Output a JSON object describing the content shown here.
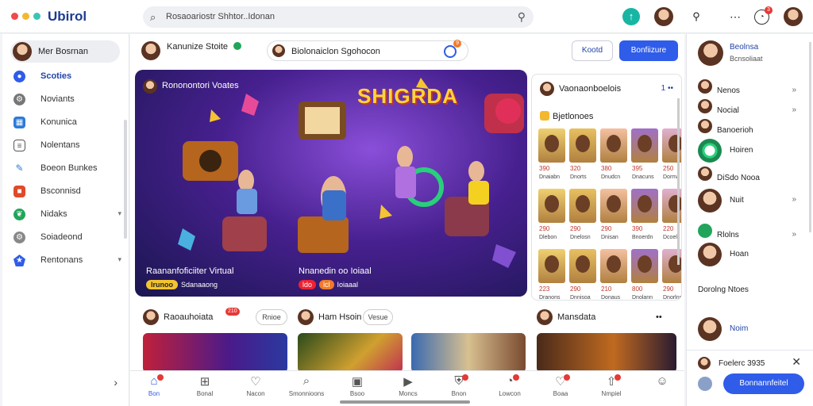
{
  "colors": {
    "accent": "#2f5ce8",
    "brand": "#1d3b8f",
    "badge": "#e53935",
    "verified": "#22a55a"
  },
  "topbar": {
    "brand": "Ubirol",
    "search_placeholder": "Rosaoariostr Shhtor..Idonan",
    "notif_count": "3"
  },
  "sidebar": {
    "profile_name": "Mer Bosrnan",
    "items": [
      {
        "label": "Scoties",
        "icon": "circle-icon"
      },
      {
        "label": "Noviants",
        "icon": "gear-icon"
      },
      {
        "label": "Konunica",
        "icon": "grid-icon"
      },
      {
        "label": "Nolentans",
        "icon": "list-icon"
      },
      {
        "label": "Boeon Bunkes",
        "icon": "pen-icon"
      },
      {
        "label": "Bsconnisd",
        "icon": "square-icon"
      },
      {
        "label": "Nidaks",
        "icon": "leaf-icon"
      },
      {
        "label": "Soiadeond",
        "icon": "settings-icon"
      },
      {
        "label": "Rentonans",
        "icon": "star-icon"
      }
    ]
  },
  "main": {
    "header": {
      "name": "Kanunize Stoite",
      "pill_text": "Biolonaiclon Sgohocon",
      "pill_badge": "9",
      "btn_secondary": "Kootd",
      "btn_primary": "Bonfiizure"
    },
    "hero": {
      "host": "Rononontori Voates",
      "logo": "SHIGRDA",
      "caption_left": "Raananfoficiiter Virtual",
      "tag_left": "lrunoo",
      "tag_left_text": "Sdanaaong",
      "caption_right": "Nnanedin oo Ioiaal",
      "tag_right_a": "ldo",
      "tag_right_b": "lcl",
      "tag_right_text": "Ioiaaal"
    },
    "gallery": {
      "title": "Vaonaonboelois",
      "more": "1 ••",
      "subtitle": "Bjetlonoes",
      "labels": [
        "390",
        "320",
        "380",
        "395",
        "250",
        "290",
        "290",
        "290",
        "390",
        "220",
        "223",
        "290",
        "210",
        "800",
        "290"
      ],
      "footer_labels": [
        "Dnaiabn",
        "Dnorts",
        "Dnudcn",
        "Dnacuns",
        "Dorma",
        "Dlebon",
        "Dnelosn",
        "Dnisan",
        "Bnoerdn",
        "Dcoels",
        "Dranons",
        "Dnnisoa",
        "Donaus",
        "Dnolann",
        "Dnorlns"
      ]
    },
    "sections": [
      {
        "title": "Raoauhoiata",
        "badge": "210",
        "btn": "Rnioe"
      },
      {
        "title": "Ham Hsoin",
        "btn": "Vesue"
      },
      {
        "title": "Mansdata",
        "more": "••"
      }
    ],
    "bottom_nav": [
      {
        "label": "Bon",
        "icon": "home-icon"
      },
      {
        "label": "Bonal",
        "icon": "plus-square-icon"
      },
      {
        "label": "Nacon",
        "icon": "heart-icon"
      },
      {
        "label": "Smonnioons",
        "icon": "search-icon"
      },
      {
        "label": "Bsoo",
        "icon": "gamepad-icon"
      },
      {
        "label": "Moncs",
        "icon": "video-icon"
      },
      {
        "label": "Bnon",
        "icon": "shield-icon"
      },
      {
        "label": "Lowcon",
        "icon": "bell-icon"
      },
      {
        "label": "Boaa",
        "icon": "heart-outline-icon"
      },
      {
        "label": "Nmpiel",
        "icon": "upload-icon"
      },
      {
        "label": "",
        "icon": "user-icon"
      }
    ]
  },
  "right": {
    "profile_name": "Beolnsa",
    "profile_sub": "Bcnsoliaat",
    "items": [
      {
        "label": "Nenos"
      },
      {
        "label": "Nocial"
      },
      {
        "label": "Banoerioh"
      },
      {
        "label": "Hoiren"
      },
      {
        "label": "DiSdo Nooa"
      },
      {
        "label": "Nuit"
      },
      {
        "label": "Rlolns"
      },
      {
        "label": "Hoan"
      },
      {
        "label": "Dorolng Ntoes"
      },
      {
        "label": "Noim"
      }
    ],
    "footer_title": "Foelerc 3935",
    "footer_button": "Bonnannfeitel"
  }
}
